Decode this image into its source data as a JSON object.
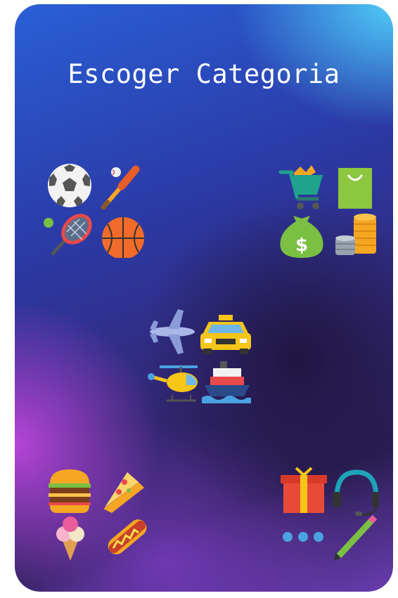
{
  "screen": {
    "title": "Escoger Categoria"
  },
  "categories": [
    {
      "id": "sports",
      "icons": [
        "soccer-ball-icon",
        "baseball-bat-icon",
        "tennis-racket-icon",
        "basketball-icon"
      ]
    },
    {
      "id": "shopping",
      "icons": [
        "shopping-cart-icon",
        "shopping-bag-icon",
        "money-bag-icon",
        "coins-icon"
      ]
    },
    {
      "id": "transport",
      "icons": [
        "airplane-icon",
        "taxi-icon",
        "helicopter-icon",
        "ship-icon"
      ]
    },
    {
      "id": "food",
      "icons": [
        "hamburger-icon",
        "pizza-slice-icon",
        "ice-cream-icon",
        "hot-dog-icon"
      ]
    },
    {
      "id": "other",
      "icons": [
        "gift-icon",
        "headset-icon",
        "ellipsis-icon",
        "pencil-icon"
      ]
    }
  ]
}
